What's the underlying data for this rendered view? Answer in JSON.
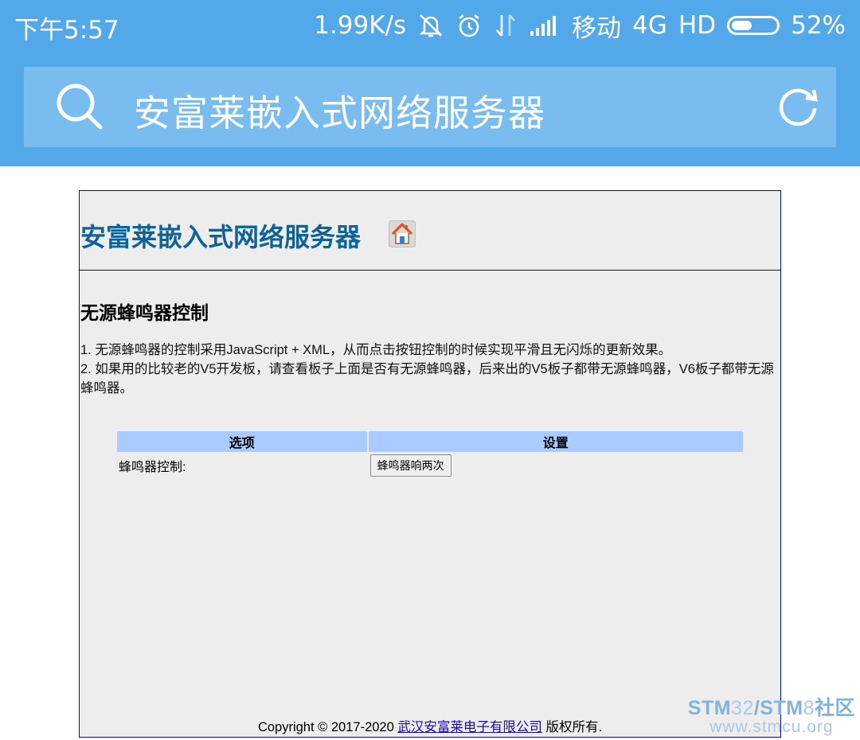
{
  "status_bar": {
    "time": "下午5:57",
    "speed": "1.99K/s",
    "carrier": "移动",
    "network": "4G",
    "hd": "HD",
    "battery_text": "52%",
    "battery_level": 0.52
  },
  "browser": {
    "address_text": "安富莱嵌入式网络服务器"
  },
  "page": {
    "heading": "安富莱嵌入式网络服务器",
    "section_title": "无源蜂鸣器控制",
    "desc_line1": "1. 无源蜂鸣器的控制采用JavaScript + XML，从而点击按钮控制的时候实现平滑且无闪烁的更新效果。",
    "desc_line2": "2. 如果用的比较老的V5开发板，请查看板子上面是否有无源蜂鸣器，后来出的V5板子都带无源蜂鸣器，V6板子都带无源蜂鸣器。",
    "table": {
      "headers": [
        "选项",
        "设置"
      ],
      "rows": [
        {
          "label": "蜂鸣器控制:",
          "button": "蜂鸣器响两次"
        }
      ]
    },
    "footer": {
      "prefix": "Copyright © 2017-2020 ",
      "link": "武汉安富莱电子有限公司",
      "suffix": " 版权所有."
    }
  },
  "watermark": {
    "line1_a": "STM",
    "line1_b": "32",
    "line1_c": "/STM",
    "line1_d": "8",
    "line1_e": "社区",
    "line2": "www.stmcu.org"
  },
  "colors": {
    "status_bar_bg": "#52a8e8",
    "address_box_bg": "#79bdf0",
    "heading": "#0e6396",
    "table_header": "#a9cbff",
    "page_bg": "#ededed"
  }
}
